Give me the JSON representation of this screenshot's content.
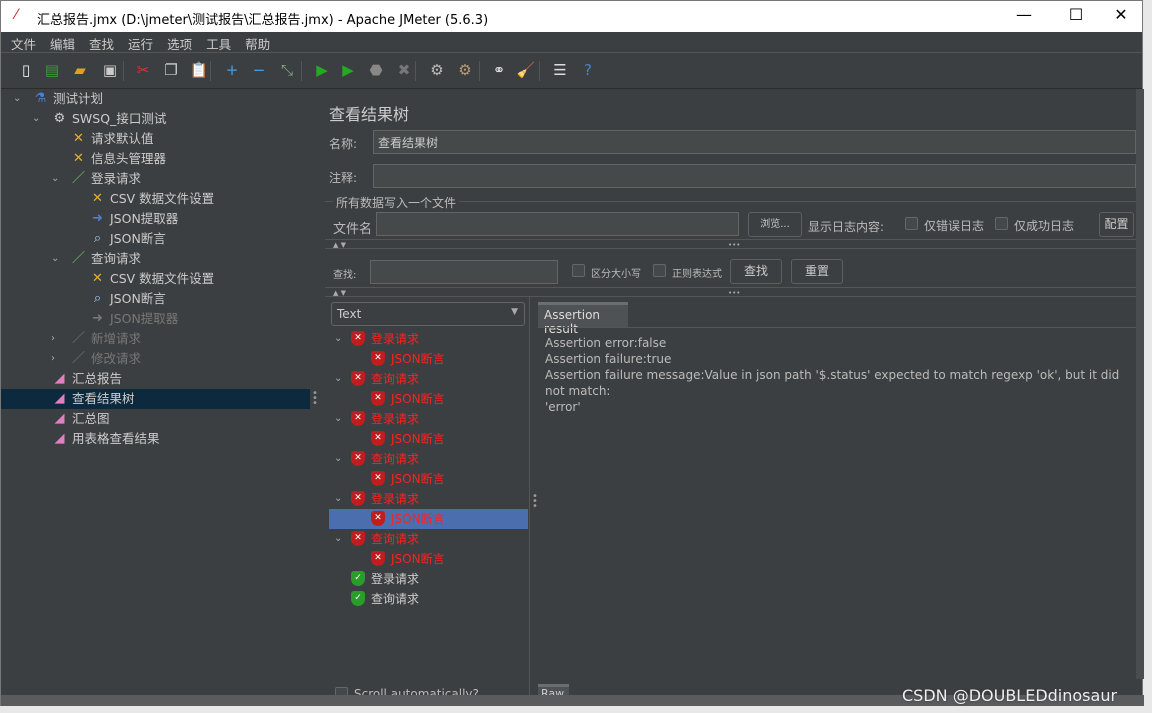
{
  "window": {
    "title": "汇总报告.jmx (D:\\jmeter\\测试报告\\汇总报告.jmx) - Apache JMeter (5.6.3)",
    "minimize": "—",
    "maximize": "☐",
    "close": "✕"
  },
  "menu": [
    "文件",
    "编辑",
    "查找",
    "运行",
    "选项",
    "工具",
    "帮助"
  ],
  "toolbar": [
    "new-icon",
    "templates-icon",
    "open-icon",
    "save-icon",
    "cut-icon",
    "copy-icon",
    "paste-icon",
    "expand-icon",
    "collapse-icon",
    "toggle-icon",
    "start-icon",
    "start-no-pause-icon",
    "stop-icon",
    "shutdown-icon",
    "clear-icon",
    "clear-all-icon",
    "search-icon",
    "reset-search-icon",
    "function-helper-icon",
    "help-icon"
  ],
  "tree": [
    {
      "label": "测试计划",
      "level": 0,
      "icon": "flask-icon",
      "arrow": "⌄"
    },
    {
      "label": "SWSQ_接口测试",
      "level": 1,
      "icon": "gear-icon",
      "arrow": "⌄"
    },
    {
      "label": "请求默认值",
      "level": 2,
      "icon": "wrench-icon"
    },
    {
      "label": "信息头管理器",
      "level": 2,
      "icon": "wrench-icon"
    },
    {
      "label": "登录请求",
      "level": 2,
      "icon": "pipette-icon",
      "arrow": "⌄"
    },
    {
      "label": "CSV 数据文件设置",
      "level": 3,
      "icon": "wrench-icon"
    },
    {
      "label": "JSON提取器",
      "level": 3,
      "icon": "extractor-icon"
    },
    {
      "label": "JSON断言",
      "level": 3,
      "icon": "magnifier-icon"
    },
    {
      "label": "查询请求",
      "level": 2,
      "icon": "pipette-icon",
      "arrow": "⌄"
    },
    {
      "label": "CSV 数据文件设置",
      "level": 3,
      "icon": "wrench-icon"
    },
    {
      "label": "JSON断言",
      "level": 3,
      "icon": "magnifier-icon"
    },
    {
      "label": "JSON提取器",
      "level": 3,
      "icon": "extractor-icon",
      "disabled": true
    },
    {
      "label": "新增请求",
      "level": 2,
      "icon": "pipette-icon",
      "arrow": "›",
      "disabled": true
    },
    {
      "label": "修改请求",
      "level": 2,
      "icon": "pipette-icon",
      "arrow": "›",
      "disabled": true
    },
    {
      "label": "汇总报告",
      "level": 1,
      "icon": "listener-icon"
    },
    {
      "label": "查看结果树",
      "level": 1,
      "icon": "listener-icon",
      "selected": true
    },
    {
      "label": "汇总图",
      "level": 1,
      "icon": "listener-icon"
    },
    {
      "label": "用表格查看结果",
      "level": 1,
      "icon": "listener-icon"
    }
  ],
  "panel": {
    "title": "查看结果树",
    "name_label": "名称:",
    "name_value": "查看结果树",
    "comment_label": "注释:",
    "comment_value": "",
    "file_group": "所有数据写入一个文件",
    "file_label": "文件名",
    "file_value": "",
    "browse": "浏览...",
    "log_label": "显示日志内容:",
    "errors_only": "仅错误日志",
    "success_only": "仅成功日志",
    "configure": "配置",
    "search_label": "查找:",
    "search_value": "",
    "case_sensitive": "区分大小写",
    "regex": "正则表达式",
    "find": "查找",
    "reset": "重置",
    "renderer": "Text",
    "tab": "Assertion result",
    "raw_tab": "Raw",
    "scroll_auto": "Scroll automatically?"
  },
  "results": [
    {
      "label": "登录请求",
      "status": "fail",
      "level": 0
    },
    {
      "label": "JSON断言",
      "status": "fail",
      "level": 1
    },
    {
      "label": "查询请求",
      "status": "fail",
      "level": 0
    },
    {
      "label": "JSON断言",
      "status": "fail",
      "level": 1
    },
    {
      "label": "登录请求",
      "status": "fail",
      "level": 0
    },
    {
      "label": "JSON断言",
      "status": "fail",
      "level": 1
    },
    {
      "label": "查询请求",
      "status": "fail",
      "level": 0
    },
    {
      "label": "JSON断言",
      "status": "fail",
      "level": 1
    },
    {
      "label": "登录请求",
      "status": "fail",
      "level": 0
    },
    {
      "label": "JSON断言",
      "status": "fail",
      "level": 1,
      "selected": true
    },
    {
      "label": "查询请求",
      "status": "fail",
      "level": 0
    },
    {
      "label": "JSON断言",
      "status": "fail",
      "level": 1
    },
    {
      "label": "登录请求",
      "status": "pass",
      "level": 0
    },
    {
      "label": "查询请求",
      "status": "pass",
      "level": 0
    }
  ],
  "assertion_text": [
    "Assertion error:false",
    "Assertion failure:true",
    "Assertion failure message:Value in json path '$.status' expected to match regexp 'ok', but it did not match:",
    "'error'"
  ],
  "watermark": "CSDN @DOUBLEDdinosaur",
  "colors": {
    "bg": "#3c3f41",
    "selection": "#4b6eaf",
    "fail": "#ff2020",
    "tree_selection": "#0d293e"
  }
}
